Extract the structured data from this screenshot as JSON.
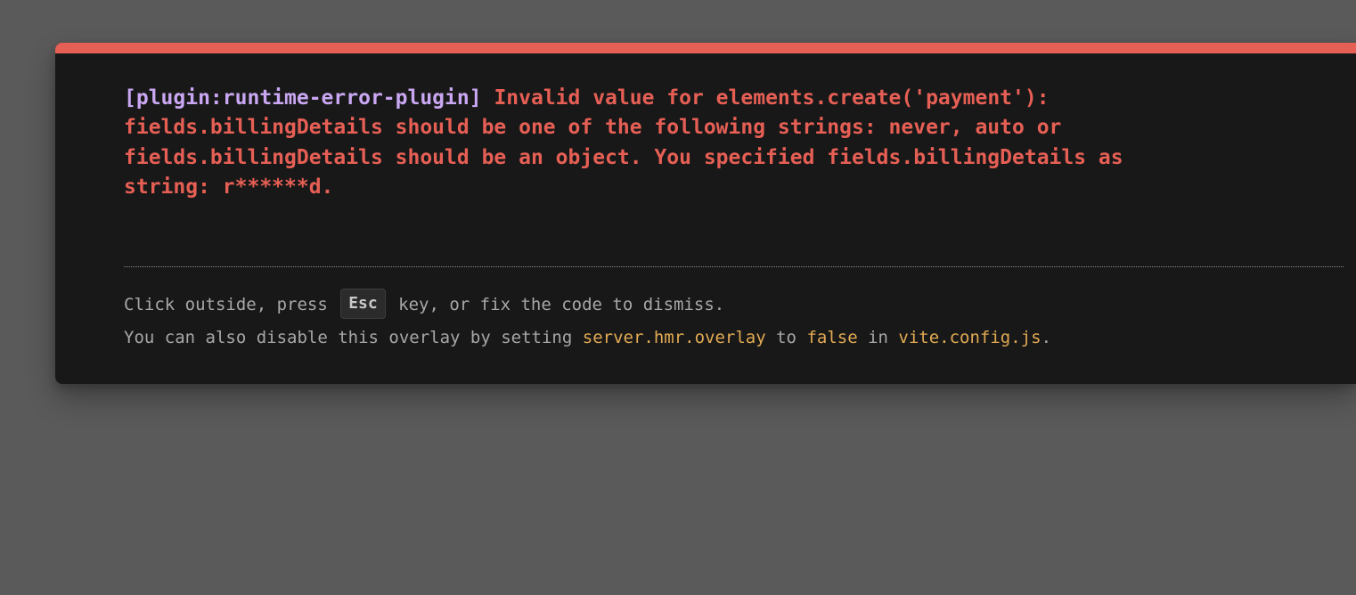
{
  "overlay": {
    "plugin": "[plugin:runtime-error-plugin]",
    "message": "Invalid value for elements.create('payment'):\nfields.billingDetails should be one of the following strings: never, auto or\nfields.billingDetails should be an object. You specified fields.billingDetails as\nstring: r******d."
  },
  "tip": {
    "line1_before": "Click outside, press ",
    "key": "Esc",
    "line1_after": " key, or fix the code to dismiss.",
    "line2_prefix": "You can also disable this overlay by setting ",
    "setting": "server.hmr.overlay",
    "to_text": " to ",
    "value": "false",
    "in_text": " in ",
    "file": "vite.config.js",
    "end": "."
  },
  "colors": {
    "accent_red": "#e65f55",
    "plugin_purple": "#c9a7f2",
    "code_yellow": "#e2aa53",
    "panel_bg": "#181818",
    "backdrop_bg": "#5a5a5a"
  }
}
